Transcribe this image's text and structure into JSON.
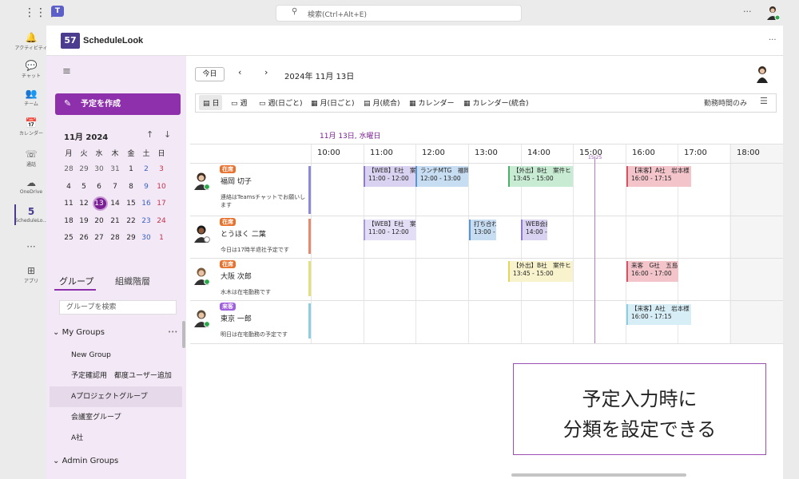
{
  "topbar": {
    "search_placeholder": "検索(Ctrl+Alt+E)",
    "more": "···"
  },
  "rail": [
    {
      "icon": "bell-icon",
      "glyph": "🔔",
      "label": "アクティビティ"
    },
    {
      "icon": "chat-icon",
      "glyph": "💬",
      "label": "チャット"
    },
    {
      "icon": "teams-icon",
      "glyph": "👥",
      "label": "チーム"
    },
    {
      "icon": "calendar-icon",
      "glyph": "📅",
      "label": "カレンダー"
    },
    {
      "icon": "phone-icon",
      "glyph": "☏",
      "label": "通話"
    },
    {
      "icon": "cloud-icon",
      "glyph": "☁",
      "label": "OneDrive"
    },
    {
      "icon": "schedulelook-icon",
      "glyph": "5",
      "label": "ScheduleLo..."
    },
    {
      "icon": "more-apps-icon",
      "glyph": "···",
      "label": ""
    },
    {
      "icon": "add-app-icon",
      "glyph": "⊞",
      "label": "アプリ"
    }
  ],
  "app": {
    "logo": "57",
    "name": "ScheduleLook",
    "more": "···"
  },
  "sidebar": {
    "create_label": "予定を作成",
    "calendar_title": "11月 2024",
    "weekdays": [
      "月",
      "火",
      "水",
      "木",
      "金",
      "土",
      "日"
    ],
    "weeks": [
      [
        "28",
        "29",
        "30",
        "31",
        "1",
        "2",
        "3"
      ],
      [
        "4",
        "5",
        "6",
        "7",
        "8",
        "9",
        "10"
      ],
      [
        "11",
        "12",
        "13",
        "14",
        "15",
        "16",
        "17"
      ],
      [
        "18",
        "19",
        "20",
        "21",
        "22",
        "23",
        "24"
      ],
      [
        "25",
        "26",
        "27",
        "28",
        "29",
        "30",
        "1"
      ]
    ],
    "tab_group": "グループ",
    "tab_org": "組織階層",
    "group_search_placeholder": "グループを検索",
    "my_groups": "My Groups",
    "my_groups_more": "•••",
    "groups": [
      "New Group",
      "予定確認用　都度ユーザー追加",
      "Aプロジェクトグループ",
      "会議室グループ",
      "A社"
    ],
    "admin_groups": "Admin Groups"
  },
  "toolbar": {
    "today": "今日",
    "prev": "‹",
    "next": "›",
    "current_date": "2024年 11月 13日",
    "views": [
      "日",
      "週",
      "週(日ごと)",
      "月(日ごと)",
      "月(統合)",
      "カレンダー",
      "カレンダー(統合)"
    ],
    "worktime": "勤務時間のみ"
  },
  "grid": {
    "date_label": "11月 13日, 水曜日",
    "hours": [
      "10:00",
      "11:00",
      "12:00",
      "13:00",
      "14:00",
      "15:00",
      "16:00",
      "17:00",
      "18:00"
    ],
    "now_label": "15:25"
  },
  "people": [
    {
      "name": "福岡 切子",
      "status": "在席",
      "status_color": "#e8712c",
      "bar_color": "#8a8ad8",
      "note": "連絡はTeamsチャットでお願いします"
    },
    {
      "name": "とうほく 二葉",
      "status": "在席",
      "status_color": "#e8712c",
      "bar_color": "#e58a6e",
      "note": "今日は17時半退社予定です"
    },
    {
      "name": "大阪 次郎",
      "status": "在席",
      "status_color": "#e8712c",
      "bar_color": "#e2e07a",
      "note": "水木は在宅勤務です"
    },
    {
      "name": "東京 一郎",
      "status": "来客",
      "status_color": "#a05fe0",
      "bar_color": "#8ccfe0",
      "note": "明日は在宅勤務の予定です"
    }
  ],
  "events": [
    {
      "title": "【WEB】E社　案",
      "time": "11:00 - 12:00",
      "bg": "#d9d2f1",
      "bd": "#8e7ad6"
    },
    {
      "title": "ランチMTG　福岡",
      "time": "12:00 - 13:00",
      "bg": "#c7ddf2",
      "bd": "#5c93d1"
    },
    {
      "title": "【外出】B社　案件ヒ",
      "time": "13:45 - 15:00",
      "bg": "#c7ecd3",
      "bd": "#4fae6b"
    },
    {
      "title": "【来客】A社　岩本様",
      "time": "16:00 - 17:15",
      "bg": "#f3c5ca",
      "bd": "#d45563"
    },
    {
      "title": "【WEB】E社　案",
      "time": "11:00 - 12:00",
      "bg": "#e4ddf6",
      "bd": "#a898e0"
    },
    {
      "title": "打ち合わ",
      "time": "13:00 -",
      "bg": "#c7ddf2",
      "bd": "#5c93d1"
    },
    {
      "title": "WEB会議",
      "time": "14:00 -",
      "bg": "#d9d2f1",
      "bd": "#8e7ad6"
    },
    {
      "title": "【外出】B社　案件ヒ",
      "time": "13:45 - 15:00",
      "bg": "#f8f3cc",
      "bd": "#e0d660"
    },
    {
      "title": "来客　G社　五島",
      "time": "16:00 - 17:00",
      "bg": "#f3c5ca",
      "bd": "#d45563"
    },
    {
      "title": "【来客】A社　岩本様",
      "time": "16:00 - 17:15",
      "bg": "#d8eef6",
      "bd": "#8ccfe0"
    }
  ],
  "callout": {
    "line1": "予定入力時に",
    "line2": "分類を設定できる"
  }
}
